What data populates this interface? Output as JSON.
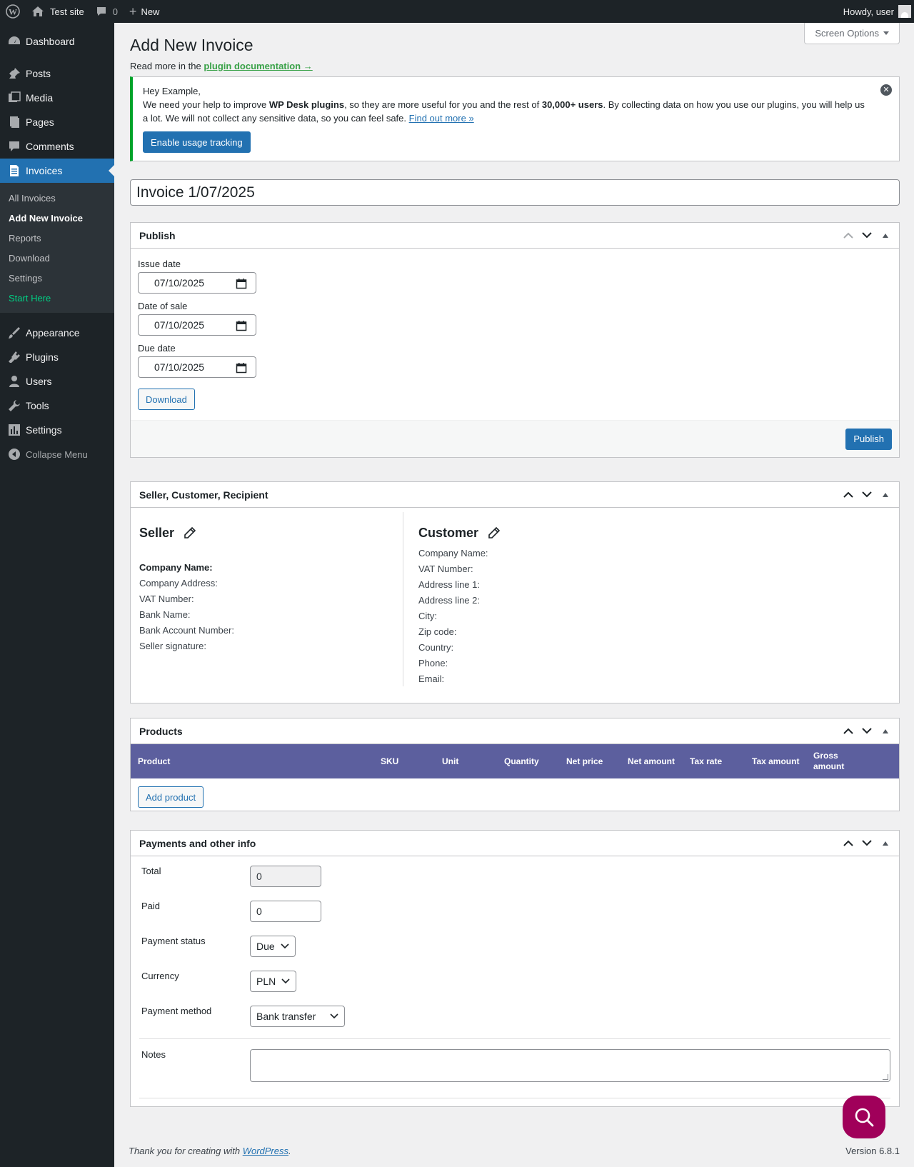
{
  "adminbar": {
    "site_name": "Test site",
    "comments_count": "0",
    "new_label": "New",
    "howdy": "Howdy, user"
  },
  "sidebar": {
    "items_top": [
      {
        "label": "Dashboard",
        "icon": "dashboard-icon"
      },
      {
        "label": "Posts",
        "icon": "pin-icon"
      },
      {
        "label": "Media",
        "icon": "media-icon"
      },
      {
        "label": "Pages",
        "icon": "pages-icon"
      },
      {
        "label": "Comments",
        "icon": "comment-icon"
      },
      {
        "label": "Invoices",
        "icon": "invoice-icon"
      }
    ],
    "submenu": [
      {
        "label": "All Invoices"
      },
      {
        "label": "Add New Invoice"
      },
      {
        "label": "Reports"
      },
      {
        "label": "Download"
      },
      {
        "label": "Settings"
      },
      {
        "label": "Start Here"
      }
    ],
    "items_bottom": [
      {
        "label": "Appearance",
        "icon": "brush-icon"
      },
      {
        "label": "Plugins",
        "icon": "plug-icon"
      },
      {
        "label": "Users",
        "icon": "user-icon"
      },
      {
        "label": "Tools",
        "icon": "wrench-icon"
      },
      {
        "label": "Settings",
        "icon": "settings-icon"
      }
    ],
    "collapse_label": "Collapse Menu"
  },
  "header": {
    "screen_options": "Screen Options",
    "title": "Add New Invoice",
    "read_more_prefix": "Read more in the",
    "read_more_link": "plugin documentation →"
  },
  "notice": {
    "greeting": "Hey Example,",
    "text_1": "We need your help to improve",
    "bold_1": "WP Desk plugins",
    "text_2": ", so they are more useful for you and the rest of",
    "bold_2": "30,000+ users",
    "text_3": ". By collecting data on how you use our plugins, you will help us a lot. We will not collect any sensitive data, so you can feel safe.",
    "link": "Find out more »",
    "button": "Enable usage tracking"
  },
  "invoice_title": "Invoice 1/07/2025",
  "publish": {
    "title": "Publish",
    "issue_date_label": "Issue date",
    "issue_date": "07/10/2025",
    "sale_date_label": "Date of sale",
    "sale_date": "07/10/2025",
    "due_date_label": "Due date",
    "due_date": "07/10/2025",
    "download_button": "Download",
    "publish_button": "Publish"
  },
  "parties": {
    "title": "Seller, Customer, Recipient",
    "seller_heading": "Seller",
    "seller_fields": [
      "Company Name:",
      "Company Address:",
      "VAT Number:",
      "Bank Name:",
      "Bank Account Number:",
      "Seller signature:"
    ],
    "customer_heading": "Customer",
    "customer_fields": [
      "Company Name:",
      "VAT Number:",
      "Address line 1:",
      "Address line 2:",
      "City:",
      "Zip code:",
      "Country:",
      "Phone:",
      "Email:"
    ]
  },
  "products": {
    "title": "Products",
    "columns": [
      "Product",
      "SKU",
      "Unit",
      "Quantity",
      "Net price",
      "Net amount",
      "Tax rate",
      "Tax amount",
      "Gross amount"
    ],
    "add_button": "Add product",
    "header_color": "#5c5f9e"
  },
  "payments": {
    "title": "Payments and other info",
    "total_label": "Total",
    "total_value": "0",
    "paid_label": "Paid",
    "paid_value": "0",
    "status_label": "Payment status",
    "status_value": "Due",
    "currency_label": "Currency",
    "currency_value": "PLN",
    "method_label": "Payment method",
    "method_value": "Bank transfer",
    "notes_label": "Notes"
  },
  "footer": {
    "thanks_prefix": "Thank you for creating with",
    "thanks_link": "WordPress",
    "thanks_suffix": ".",
    "version": "Version 6.8.1"
  },
  "colors": {
    "accent": "#2271b1",
    "admin_dark": "#1d2327",
    "notice_border": "#00a32a",
    "fab": "#a0005a"
  }
}
